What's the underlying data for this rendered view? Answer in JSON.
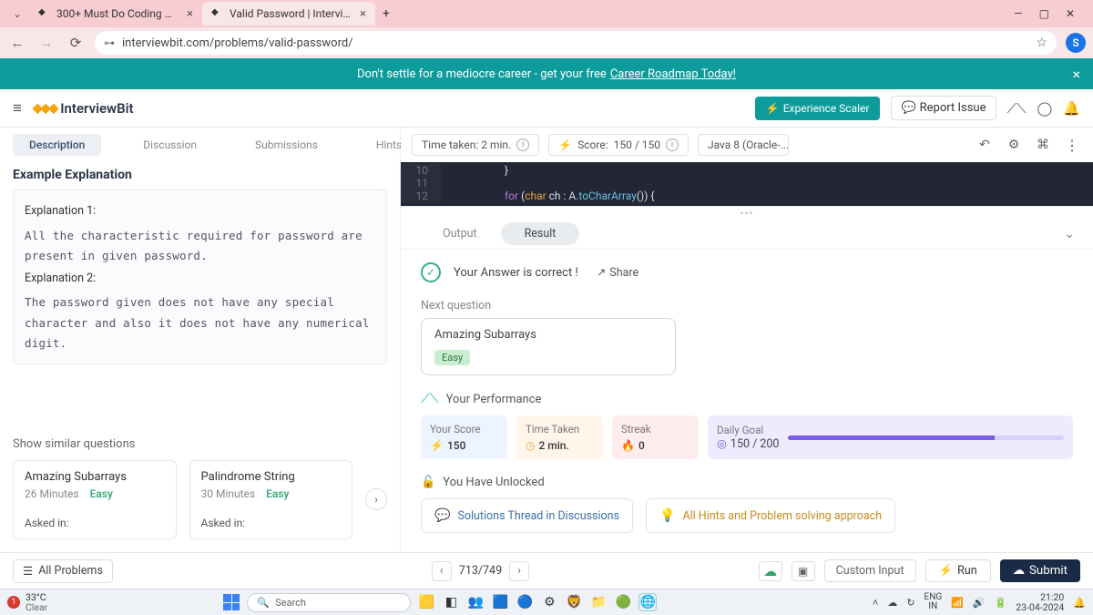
{
  "browser": {
    "tabs": [
      {
        "title": "300+ Must Do Coding Questio",
        "active": false
      },
      {
        "title": "Valid Password | Interviewbit",
        "active": true
      }
    ],
    "url": "interviewbit.com/problems/valid-password/",
    "profile_initial": "S",
    "window_controls": {
      "min": "—",
      "max": "▢",
      "close": "✕"
    }
  },
  "promo": {
    "text": "Don't settle for a mediocre career - get your free",
    "link": "Career Roadmap Today!"
  },
  "app_header": {
    "brand": "InterviewBit",
    "experience_btn": "Experience Scaler",
    "report_issue": "Report Issue"
  },
  "left": {
    "tabs": [
      "Description",
      "Discussion",
      "Submissions",
      "Hints"
    ],
    "active_tab": "Description",
    "section_title": "Example Explanation",
    "exp1_label": "Explanation 1:",
    "exp1_text": "All the characteristic required for password are present in given password.",
    "exp2_label": "Explanation 2:",
    "exp2_text": "The password given does not have any special character and also it does not have any numerical digit.",
    "similar_label": "Show similar questions",
    "similar": [
      {
        "name": "Amazing Subarrays",
        "time": "26 Minutes",
        "diff": "Easy",
        "asked": "Asked in:"
      },
      {
        "name": "Palindrome String",
        "time": "30 Minutes",
        "diff": "Easy",
        "asked": "Asked in:"
      }
    ]
  },
  "right": {
    "time_taken_chip": "Time taken: 2 min.",
    "score_chip_prefix": "Score:",
    "score_chip_value": "150  /  150",
    "lang": "Java 8 (Oracle-...",
    "code_lines": [
      {
        "num": "10",
        "txt": "}"
      },
      {
        "num": "11",
        "txt": ""
      },
      {
        "num": "12",
        "txt": "for (char ch : A.toCharArray()) {"
      }
    ],
    "result_tabs": [
      "Output",
      "Result"
    ],
    "result_active": "Result",
    "correct_msg": "Your Answer is correct !",
    "share": "Share",
    "next_label": "Next question",
    "next_card": {
      "name": "Amazing Subarrays",
      "diff": "Easy"
    },
    "perf_label": "Your Performance",
    "metrics": {
      "score": {
        "label": "Your Score",
        "value": "150"
      },
      "time": {
        "label": "Time Taken",
        "value": "2 min."
      },
      "streak": {
        "label": "Streak",
        "value": "0"
      },
      "goal": {
        "label": "Daily Goal",
        "value": "150 / 200",
        "pct": 75
      }
    },
    "unlocked_label": "You Have Unlocked",
    "unlocked": [
      "Solutions Thread in Discussions",
      "All Hints and Problem solving approach"
    ]
  },
  "footer": {
    "all_problems": "All Problems",
    "pager": "713/749",
    "custom_input": "Custom Input",
    "run": "Run",
    "submit": "Submit"
  },
  "taskbar": {
    "temp": "33°C",
    "cond": "Clear",
    "search_placeholder": "Search",
    "lang1": "ENG",
    "lang2": "IN",
    "time": "21:20",
    "date": "23-04-2024"
  }
}
